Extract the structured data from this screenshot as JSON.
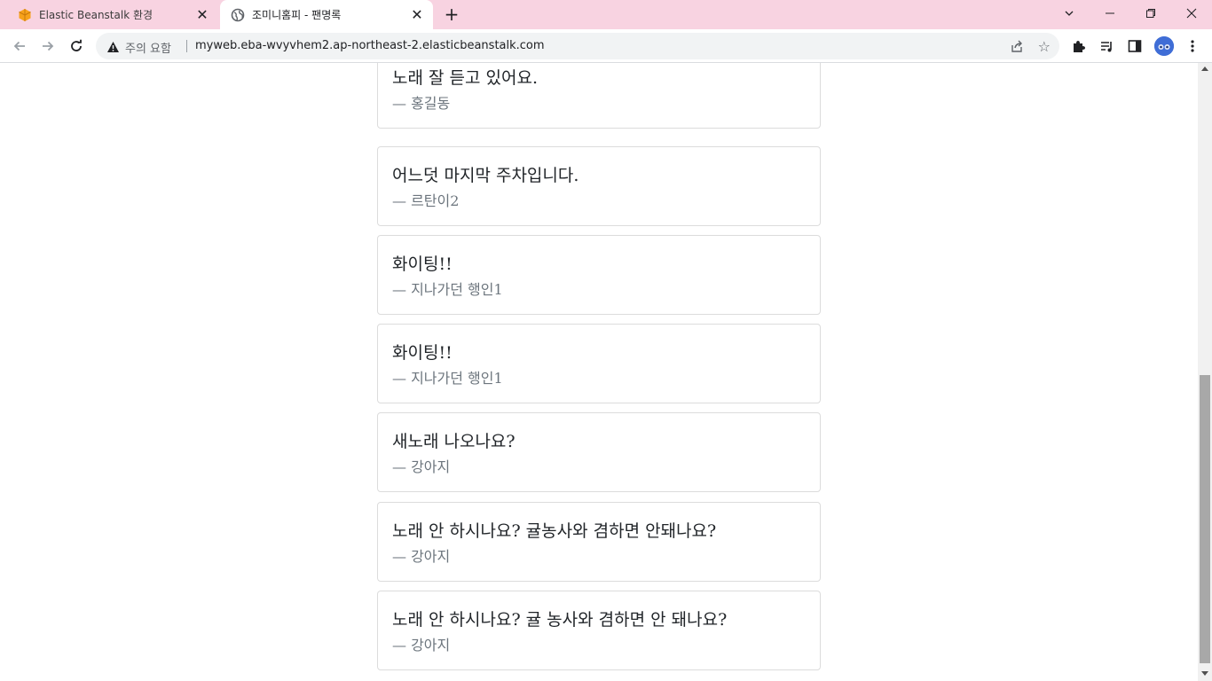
{
  "browser": {
    "tabs": [
      {
        "title": "Elastic Beanstalk 환경",
        "icon": "aws-box-icon",
        "active": false
      },
      {
        "title": "조미니홈피 - 팬명록",
        "icon": "globe-icon",
        "active": true
      }
    ],
    "address_bar": {
      "security_label": "주의 요함",
      "url": "myweb.eba-wvyvhem2.ap-northeast-2.elasticbeanstalk.com"
    },
    "colors": {
      "tabstrip": "#f8d3e1",
      "aws_orange": "#f7a21b",
      "avatar": "#3f6dd6"
    }
  },
  "guestbook": {
    "entries": [
      {
        "message": "노래 잘 듣고 있어요.",
        "author": "— 홍길동"
      },
      {
        "message": "어느덧 마지막 주차입니다.",
        "author": "— 르탄이2"
      },
      {
        "message": "화이팅!!",
        "author": "— 지나가던 행인1"
      },
      {
        "message": "화이팅!!",
        "author": "— 지나가던 행인1"
      },
      {
        "message": "새노래 나오나요?",
        "author": "— 강아지"
      },
      {
        "message": "노래 안 하시나요? 귤농사와 겸하면 안돼나요?",
        "author": "— 강아지"
      },
      {
        "message": "노래 안 하시나요? 귤 농사와 겸하면 안 돼나요?",
        "author": "— 강아지"
      }
    ]
  }
}
